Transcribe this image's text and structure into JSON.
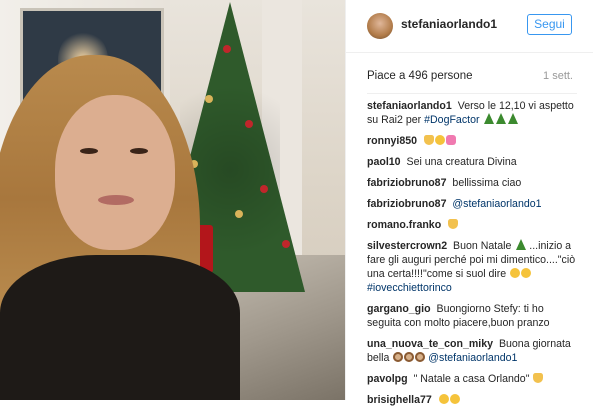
{
  "post": {
    "username": "stefaniaorlando1",
    "follow_label": "Segui",
    "likes": "Piace a 496 persone",
    "time": "1 sett."
  },
  "comments": [
    {
      "user": "stefaniaorlando1",
      "text": "Verso le 12,10 vi aspetto su Rai2 per",
      "link": "#DogFactor",
      "emoji": [
        "tree",
        "tree",
        "tree"
      ]
    },
    {
      "user": "ronnyi850",
      "text": "",
      "emoji": [
        "thumb",
        "yellow",
        "pink"
      ]
    },
    {
      "user": "paol10",
      "text": "Sei una creatura Divina",
      "emoji": []
    },
    {
      "user": "fabriziobruno87",
      "text": "bellissima ciao",
      "emoji": []
    },
    {
      "user": "fabriziobruno87",
      "text": "",
      "link": "@stefaniaorlando1",
      "emoji": []
    },
    {
      "user": "romano.franko",
      "text": "",
      "emoji": [
        "thumb"
      ]
    },
    {
      "user": "silvestercrown2",
      "text": "Buon Natale",
      "text2": "...inizio a fare gli auguri perché poi mi dimentico....\"ciò una certa!!!!\"come si suol dire",
      "link": "#iovecchiettorinco",
      "emoji": [
        "tree"
      ]
    },
    {
      "user": "gargano_gio",
      "text": "Buongiorno Stefy: ti ho seguita con molto piacere,buon pranzo",
      "emoji": []
    },
    {
      "user": "una_nuova_te_con_miky",
      "text": "Buona giornata bella",
      "link": "@stefaniaorlando1",
      "emoji": [
        "dog",
        "dog",
        "dog"
      ]
    },
    {
      "user": "pavolpg",
      "text": "\" Natale a casa Orlando\"",
      "emoji": [
        "thumb"
      ]
    },
    {
      "user": "brisighella77",
      "text": "",
      "emoji": [
        "yellow",
        "yellow"
      ]
    }
  ],
  "icons": {
    "tree": "christmas-tree-icon",
    "thumb": "thumbs-up-icon",
    "yellow": "smiley-icon",
    "pink": "hearts-icon",
    "dog": "dog-face-icon"
  },
  "colors": {
    "accent": "#3897f0",
    "link": "#003569",
    "muted": "#999999"
  }
}
